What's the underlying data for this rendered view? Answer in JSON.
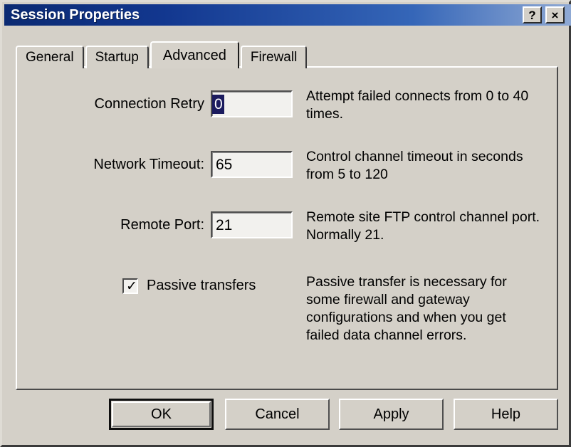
{
  "window": {
    "title": "Session Properties",
    "titlebar_buttons": [
      {
        "name": "help-titlebar-button",
        "glyph": "?"
      },
      {
        "name": "close-titlebar-button",
        "glyph": "×"
      }
    ]
  },
  "tabs": [
    {
      "label": "General",
      "active": false
    },
    {
      "label": "Startup",
      "active": false
    },
    {
      "label": "Advanced",
      "active": true
    },
    {
      "label": "Firewall",
      "active": false
    }
  ],
  "form": {
    "rows": [
      {
        "label": "Connection Retry",
        "value": "0",
        "selected": true,
        "description": "Attempt failed connects from 0 to 40 times."
      },
      {
        "label": "Network Timeout:",
        "value": "65",
        "selected": false,
        "description": "Control channel timeout in seconds from 5 to 120"
      },
      {
        "label": "Remote Port:",
        "value": "21",
        "selected": false,
        "description": "Remote site FTP control channel port. Normally 21."
      }
    ],
    "checkbox": {
      "label": "Passive transfers",
      "checked": true,
      "check_glyph": "✓",
      "description": "Passive transfer is necessary for some firewall and gateway configurations and when you get failed data channel errors."
    }
  },
  "buttons": [
    {
      "label": "OK",
      "default": true
    },
    {
      "label": "Cancel",
      "default": false
    },
    {
      "label": "Apply",
      "default": false
    },
    {
      "label": "Help",
      "default": false
    }
  ],
  "colors": {
    "face": "#d4d0c8",
    "title_gradient_start": "#0b2a72",
    "title_gradient_end": "#8fa9d4",
    "selection": "#1b1b5e",
    "field_background": "#f2f1ee"
  }
}
